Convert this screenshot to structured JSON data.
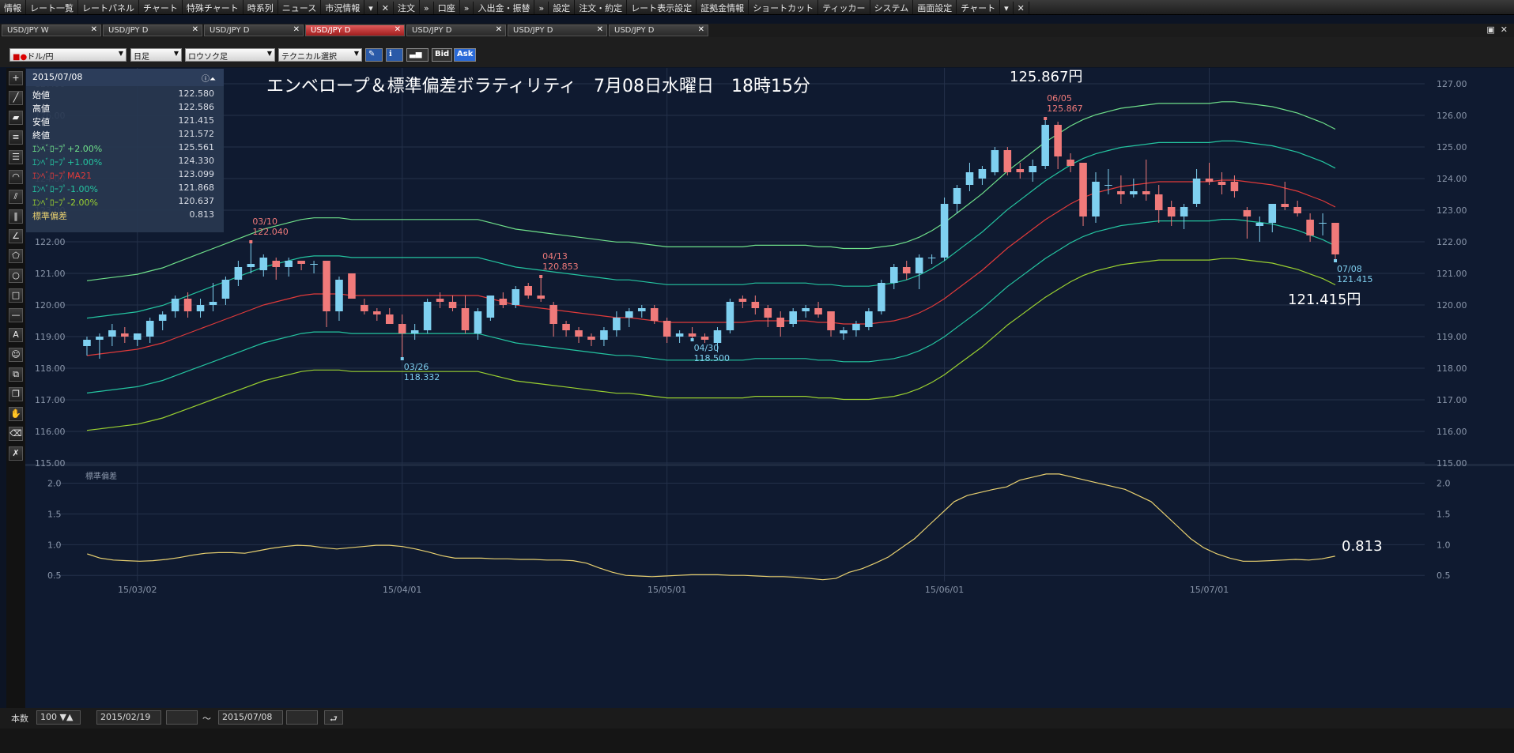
{
  "menu": {
    "items": [
      "情報",
      "レート一覧",
      "レートパネル",
      "チャート",
      "特殊チャート",
      "時系列",
      "ニュース",
      "市況情報",
      "▾",
      "✕",
      "注文",
      "»",
      "口座",
      "»",
      "入出金・振替",
      "»",
      "設定",
      "注文・約定",
      "レート表示設定",
      "証拠金情報",
      "ショートカット",
      "ティッカー",
      "システム",
      "画面設定",
      "チャート",
      "▾",
      "✕"
    ]
  },
  "tabs": [
    {
      "label": "USD/JPY W",
      "active": false
    },
    {
      "label": "USD/JPY D",
      "active": false
    },
    {
      "label": "USD/JPY D",
      "active": false
    },
    {
      "label": "USD/JPY D",
      "active": true
    },
    {
      "label": "USD/JPY D",
      "active": false
    },
    {
      "label": "USD/JPY D",
      "active": false
    },
    {
      "label": "USD/JPY D",
      "active": false
    }
  ],
  "toolbar": {
    "pair": "ドル/円",
    "period": "日足",
    "chart_type": "ロウソク足",
    "technical": "テクニカル選択",
    "bid": "Bid",
    "ask": "Ask"
  },
  "info_panel": {
    "date": "2015/07/08",
    "rows": [
      {
        "k": "始値",
        "v": "122.580",
        "color": "#ffffff"
      },
      {
        "k": "高値",
        "v": "122.586",
        "color": "#ffffff"
      },
      {
        "k": "安値",
        "v": "121.415",
        "color": "#ffffff"
      },
      {
        "k": "終値",
        "v": "121.572",
        "color": "#ffffff"
      },
      {
        "k": "ｴﾝﾍﾞﾛｰﾌﾟ+2.00%",
        "v": "125.561",
        "color": "#6fe08a"
      },
      {
        "k": "ｴﾝﾍﾞﾛｰﾌﾟ+1.00%",
        "v": "124.330",
        "color": "#24c4a0"
      },
      {
        "k": "ｴﾝﾍﾞﾛｰﾌﾟMA21",
        "v": "123.099",
        "color": "#e03a3a"
      },
      {
        "k": "ｴﾝﾍﾞﾛｰﾌﾟ-1.00%",
        "v": "121.868",
        "color": "#24c4a0"
      },
      {
        "k": "ｴﾝﾍﾞﾛｰﾌﾟ-2.00%",
        "v": "120.637",
        "color": "#9ad030"
      },
      {
        "k": "標準偏差",
        "v": "0.813",
        "color": "#e8d070"
      }
    ]
  },
  "chart": {
    "title": "エンベロープ＆標準偏差ボラティリティ　7月08日水曜日　18時15分",
    "high_label": "125.867円",
    "low_label": "121.415円",
    "sd_label": "0.813",
    "sub_title": "標準偏差",
    "x_ticks": [
      "15/03/02",
      "15/04/01",
      "15/05/01",
      "15/06/01",
      "15/07/01"
    ],
    "annotations": [
      {
        "date": "03/10",
        "price": "122.040",
        "kind": "high"
      },
      {
        "date": "03/26",
        "price": "118.332",
        "kind": "low"
      },
      {
        "date": "04/13",
        "price": "120.853",
        "kind": "high"
      },
      {
        "date": "04/30",
        "price": "118.500",
        "kind": "low"
      },
      {
        "date": "06/05",
        "price": "125.867",
        "kind": "high"
      },
      {
        "date": "07/08",
        "price": "121.415",
        "kind": "low"
      }
    ]
  },
  "chart_data": {
    "type": "candlestick",
    "title": "エンベロープ＆標準偏差ボラティリティ　7月08日水曜日　18時15分",
    "ylim": [
      115,
      127
    ],
    "y_ticks": [
      "115.00",
      "116.00",
      "117.00",
      "118.00",
      "119.00",
      "120.00",
      "121.00",
      "122.00",
      "123.00",
      "124.00",
      "125.00",
      "126.00",
      "127.00"
    ],
    "sub_ylim": [
      0.4,
      2.2
    ],
    "sub_y_ticks": [
      "0.5",
      "1.0",
      "1.5",
      "2.0"
    ],
    "candles": [
      [
        118.7,
        119.0,
        118.4,
        118.9
      ],
      [
        118.9,
        119.1,
        118.3,
        119.0
      ],
      [
        119.0,
        119.4,
        118.7,
        119.2
      ],
      [
        119.1,
        119.3,
        118.8,
        119.0
      ],
      [
        118.9,
        119.1,
        118.7,
        119.1
      ],
      [
        119.0,
        119.6,
        118.8,
        119.5
      ],
      [
        119.5,
        119.8,
        119.2,
        119.7
      ],
      [
        119.8,
        120.3,
        119.6,
        120.2
      ],
      [
        120.2,
        120.4,
        119.6,
        119.8
      ],
      [
        119.8,
        120.2,
        119.6,
        120.0
      ],
      [
        120.0,
        120.7,
        119.8,
        120.1
      ],
      [
        120.2,
        120.9,
        120.0,
        120.8
      ],
      [
        120.8,
        121.4,
        120.6,
        121.2
      ],
      [
        121.2,
        122.0,
        121.0,
        121.3
      ],
      [
        121.1,
        121.6,
        120.9,
        121.5
      ],
      [
        121.4,
        121.5,
        120.8,
        121.2
      ],
      [
        121.2,
        121.5,
        120.9,
        121.4
      ],
      [
        121.4,
        121.4,
        121.1,
        121.3
      ],
      [
        121.3,
        121.4,
        121.0,
        121.3
      ],
      [
        121.4,
        121.4,
        119.3,
        119.8
      ],
      [
        119.8,
        120.9,
        119.5,
        120.8
      ],
      [
        121.0,
        121.0,
        120.2,
        120.2
      ],
      [
        120.0,
        120.2,
        119.7,
        119.8
      ],
      [
        119.8,
        119.9,
        119.5,
        119.7
      ],
      [
        119.7,
        119.9,
        119.4,
        119.4
      ],
      [
        119.4,
        119.7,
        118.3,
        119.1
      ],
      [
        119.1,
        119.4,
        118.9,
        119.2
      ],
      [
        119.2,
        120.2,
        119.1,
        120.1
      ],
      [
        120.2,
        120.4,
        119.9,
        120.1
      ],
      [
        120.1,
        120.3,
        119.8,
        119.9
      ],
      [
        119.9,
        120.3,
        119.1,
        119.2
      ],
      [
        119.1,
        119.9,
        118.9,
        119.8
      ],
      [
        119.6,
        120.3,
        119.5,
        120.3
      ],
      [
        120.2,
        120.4,
        119.9,
        120.0
      ],
      [
        120.0,
        120.6,
        119.9,
        120.5
      ],
      [
        120.6,
        120.7,
        120.2,
        120.3
      ],
      [
        120.3,
        120.9,
        120.1,
        120.2
      ],
      [
        120.0,
        120.1,
        119.0,
        119.4
      ],
      [
        119.4,
        119.5,
        119.0,
        119.2
      ],
      [
        119.2,
        119.3,
        118.8,
        119.0
      ],
      [
        119.0,
        119.1,
        118.7,
        118.9
      ],
      [
        118.9,
        119.3,
        118.7,
        119.2
      ],
      [
        119.2,
        119.8,
        119.0,
        119.6
      ],
      [
        119.6,
        119.9,
        119.3,
        119.8
      ],
      [
        119.8,
        120.0,
        119.6,
        119.9
      ],
      [
        119.9,
        120.0,
        119.4,
        119.5
      ],
      [
        119.5,
        119.6,
        118.8,
        119.0
      ],
      [
        119.0,
        119.2,
        118.8,
        119.1
      ],
      [
        119.1,
        119.3,
        118.9,
        119.0
      ],
      [
        119.0,
        119.1,
        118.8,
        118.9
      ],
      [
        118.8,
        119.3,
        118.5,
        119.2
      ],
      [
        119.2,
        120.2,
        119.1,
        120.1
      ],
      [
        120.2,
        120.3,
        119.9,
        120.1
      ],
      [
        120.1,
        120.3,
        119.7,
        119.9
      ],
      [
        119.9,
        120.0,
        119.3,
        119.6
      ],
      [
        119.6,
        119.8,
        119.0,
        119.3
      ],
      [
        119.4,
        119.9,
        119.3,
        119.8
      ],
      [
        119.8,
        120.0,
        119.6,
        119.9
      ],
      [
        119.9,
        120.1,
        119.6,
        119.7
      ],
      [
        119.8,
        119.8,
        119.0,
        119.2
      ],
      [
        119.1,
        119.3,
        118.9,
        119.2
      ],
      [
        119.2,
        119.5,
        119.0,
        119.4
      ],
      [
        119.3,
        119.9,
        119.2,
        119.8
      ],
      [
        119.8,
        120.8,
        119.7,
        120.7
      ],
      [
        120.7,
        121.3,
        120.5,
        121.2
      ],
      [
        121.2,
        121.4,
        120.8,
        121.0
      ],
      [
        121.0,
        121.6,
        120.5,
        121.5
      ],
      [
        121.5,
        121.6,
        121.3,
        121.5
      ],
      [
        121.5,
        123.4,
        121.4,
        123.2
      ],
      [
        123.2,
        123.8,
        122.9,
        123.7
      ],
      [
        123.8,
        124.5,
        123.6,
        124.2
      ],
      [
        124.0,
        124.4,
        123.8,
        124.3
      ],
      [
        124.2,
        125.0,
        124.1,
        124.9
      ],
      [
        124.9,
        125.0,
        124.1,
        124.2
      ],
      [
        124.3,
        124.5,
        124.0,
        124.2
      ],
      [
        124.2,
        124.6,
        123.9,
        124.4
      ],
      [
        124.4,
        125.9,
        124.3,
        125.7
      ],
      [
        125.7,
        125.8,
        124.3,
        124.7
      ],
      [
        124.6,
        124.8,
        124.2,
        124.4
      ],
      [
        124.5,
        124.5,
        122.5,
        122.8
      ],
      [
        122.8,
        124.2,
        122.6,
        123.9
      ],
      [
        123.8,
        124.3,
        123.5,
        123.8
      ],
      [
        123.6,
        124.1,
        123.2,
        123.5
      ],
      [
        123.5,
        124.0,
        123.4,
        123.6
      ],
      [
        123.6,
        124.6,
        123.3,
        123.5
      ],
      [
        123.5,
        123.8,
        122.6,
        123.0
      ],
      [
        123.1,
        123.3,
        122.5,
        122.8
      ],
      [
        122.8,
        123.2,
        122.4,
        123.1
      ],
      [
        123.2,
        124.3,
        123.1,
        124.0
      ],
      [
        124.0,
        124.5,
        123.8,
        123.9
      ],
      [
        123.9,
        124.2,
        123.5,
        123.8
      ],
      [
        123.9,
        124.1,
        123.4,
        123.6
      ],
      [
        123.0,
        123.1,
        122.1,
        122.8
      ],
      [
        122.5,
        122.8,
        122.0,
        122.6
      ],
      [
        122.6,
        123.2,
        122.3,
        123.2
      ],
      [
        123.2,
        123.9,
        123.0,
        123.1
      ],
      [
        123.1,
        123.3,
        122.8,
        122.9
      ],
      [
        122.7,
        122.9,
        122.0,
        122.2
      ],
      [
        122.6,
        122.9,
        122.2,
        122.6
      ],
      [
        122.6,
        122.6,
        121.4,
        121.6
      ]
    ],
    "ma21_start": [
      118.4,
      120.8,
      119.1,
      120.0,
      124.1
    ],
    "series": [
      {
        "name": "ｴﾝﾍﾞﾛｰﾌﾟ+2.00%",
        "color": "#6fe08a"
      },
      {
        "name": "ｴﾝﾍﾞﾛｰﾌﾟ+1.00%",
        "color": "#24c4a0"
      },
      {
        "name": "ｴﾝﾍﾞﾛｰﾌﾟMA21",
        "color": "#e03a3a"
      },
      {
        "name": "ｴﾝﾍﾞﾛｰﾌﾟ-1.00%",
        "color": "#24c4a0"
      },
      {
        "name": "ｴﾝﾍﾞﾛｰﾌﾟ-2.00%",
        "color": "#9ad030"
      },
      {
        "name": "標準偏差",
        "color": "#e8d070"
      }
    ],
    "ma21": [
      118.4,
      118.45,
      118.5,
      118.55,
      118.6,
      118.7,
      118.8,
      118.95,
      119.1,
      119.25,
      119.4,
      119.55,
      119.7,
      119.85,
      120.0,
      120.1,
      120.2,
      120.3,
      120.35,
      120.35,
      120.35,
      120.3,
      120.3,
      120.3,
      120.3,
      120.3,
      120.3,
      120.3,
      120.3,
      120.3,
      120.3,
      120.3,
      120.2,
      120.1,
      120.0,
      119.95,
      119.9,
      119.85,
      119.8,
      119.75,
      119.7,
      119.65,
      119.6,
      119.6,
      119.55,
      119.5,
      119.45,
      119.45,
      119.45,
      119.45,
      119.45,
      119.45,
      119.45,
      119.5,
      119.5,
      119.5,
      119.5,
      119.5,
      119.45,
      119.45,
      119.4,
      119.4,
      119.4,
      119.45,
      119.5,
      119.6,
      119.75,
      119.95,
      120.2,
      120.5,
      120.8,
      121.1,
      121.45,
      121.8,
      122.1,
      122.4,
      122.7,
      122.95,
      123.2,
      123.4,
      123.55,
      123.65,
      123.75,
      123.8,
      123.85,
      123.9,
      123.9,
      123.9,
      123.9,
      123.9,
      123.95,
      123.95,
      123.9,
      123.85,
      123.8,
      123.7,
      123.6,
      123.45,
      123.3,
      123.1
    ],
    "std_dev": [
      0.85,
      0.78,
      0.75,
      0.74,
      0.73,
      0.74,
      0.76,
      0.79,
      0.83,
      0.86,
      0.87,
      0.87,
      0.86,
      0.9,
      0.94,
      0.97,
      0.99,
      0.98,
      0.95,
      0.93,
      0.95,
      0.97,
      0.99,
      0.99,
      0.97,
      0.93,
      0.88,
      0.82,
      0.78,
      0.78,
      0.78,
      0.77,
      0.77,
      0.76,
      0.76,
      0.75,
      0.75,
      0.74,
      0.7,
      0.62,
      0.55,
      0.5,
      0.49,
      0.48,
      0.49,
      0.5,
      0.51,
      0.51,
      0.51,
      0.5,
      0.5,
      0.49,
      0.48,
      0.48,
      0.47,
      0.45,
      0.43,
      0.45,
      0.55,
      0.61,
      0.7,
      0.8,
      0.95,
      1.1,
      1.3,
      1.5,
      1.7,
      1.8,
      1.85,
      1.9,
      1.94,
      2.05,
      2.1,
      2.15,
      2.15,
      2.1,
      2.05,
      2.0,
      1.95,
      1.9,
      1.8,
      1.7,
      1.5,
      1.3,
      1.1,
      0.95,
      0.85,
      0.78,
      0.73,
      0.73,
      0.74,
      0.75,
      0.76,
      0.75,
      0.77,
      0.813
    ],
    "x_ticks": [
      "15/03/02",
      "15/04/01",
      "15/05/01",
      "15/06/01",
      "15/07/01"
    ]
  }
}
